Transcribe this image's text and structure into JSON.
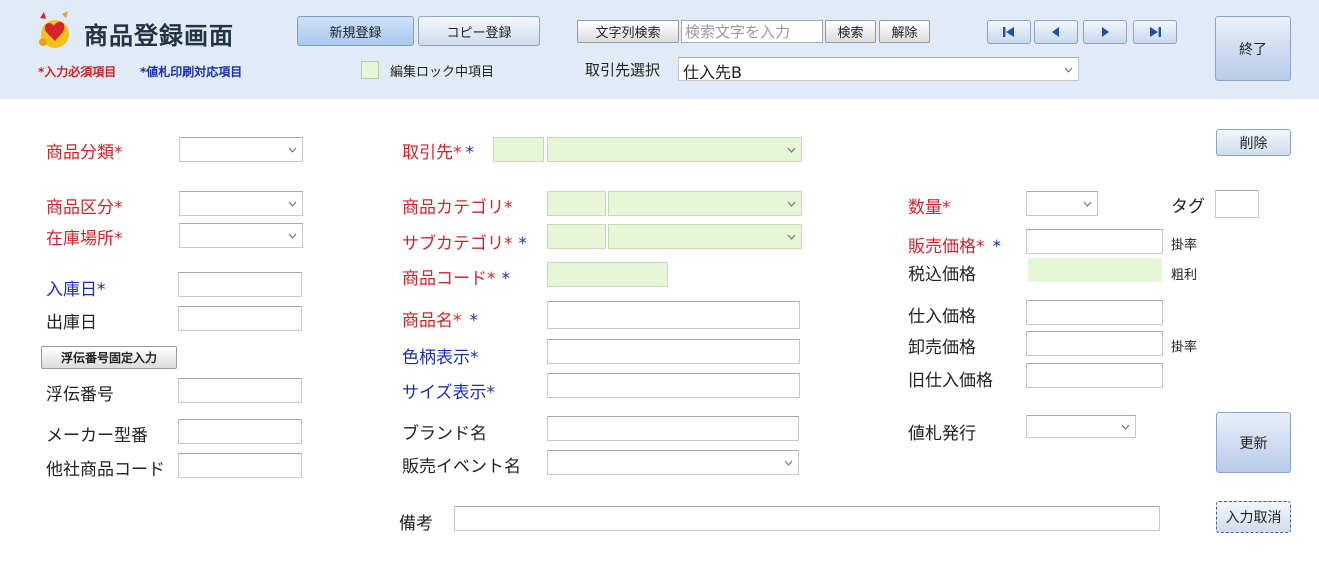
{
  "header": {
    "title": "商品登録画面",
    "note_required": "*入力必須項目",
    "note_print": "*値札印刷対応項目",
    "new_register": "新規登録",
    "copy_register": "コピー登録",
    "lock_legend": "編集ロック中項目",
    "string_search": "文字列検索",
    "search_placeholder": "検索文字を入力",
    "search_button": "検索",
    "clear_button": "解除",
    "supplier_select_label": "取引先選択",
    "supplier_select_value": "仕入先B",
    "exit_button": "終了"
  },
  "form": {
    "product_class": "商品分類",
    "product_division": "商品区分",
    "stock_location": "在庫場所",
    "arrival_date": "入庫日",
    "shipping_date": "出庫日",
    "slip_fixed_input": "浮伝番号固定入力",
    "slip_number": "浮伝番号",
    "maker_model": "メーカー型番",
    "other_company_code": "他社商品コード",
    "supplier": "取引先",
    "category": "商品カテゴリ",
    "subcategory": "サブカテゴリ",
    "product_code": "商品コード",
    "product_name": "商品名",
    "color_display": "色柄表示",
    "size_display": "サイズ表示",
    "brand_name": "ブランド名",
    "sales_event_name": "販売イベント名",
    "remarks": "備考",
    "quantity": "数量",
    "tag": "タグ",
    "sale_price": "販売価格",
    "rate1": "掛率",
    "tax_included_price": "税込価格",
    "gross_profit": "粗利",
    "purchase_price": "仕入価格",
    "wholesale_price": "卸売価格",
    "rate2": "掛率",
    "old_purchase_price": "旧仕入価格",
    "price_tag_issue": "値札発行",
    "delete_button": "削除",
    "update_button": "更新",
    "cancel_input_button": "入力取消",
    "star": "*"
  },
  "colors": {
    "required": "#d2232a",
    "print": "#1a2fb0",
    "locked_field": "#e8f6d8",
    "header_bg": "#e0ebf7"
  }
}
